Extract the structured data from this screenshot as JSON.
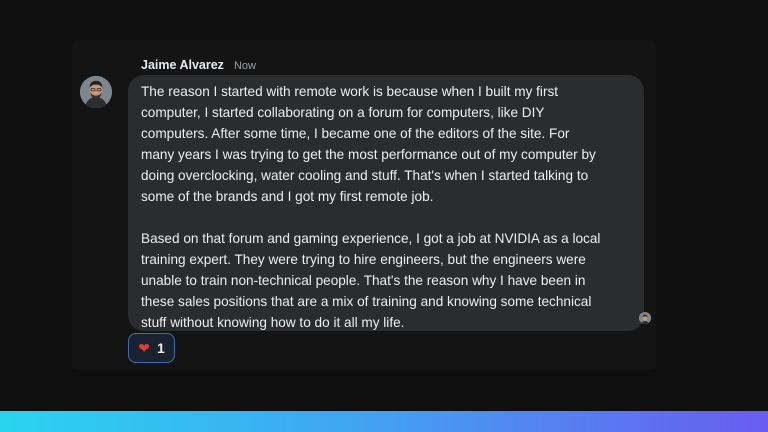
{
  "message": {
    "sender": "Jaime Alvarez",
    "timestamp": "Now",
    "paragraphs": [
      "The reason I started with remote work is because when I built my first computer, I started collaborating on a forum for computers, like DIY computers. After some time, I became one of the editors of the site. For many years I was trying to get the most performance out of my computer by doing overclocking, water cooling and stuff. That's when I started talking to some of the brands and I got my first remote job.",
      "Based on that forum and gaming experience, I got a job at NVIDIA as a local training expert. They were trying to hire engineers, but the engineers were unable to train non-technical people. That's the reason why I have been in these sales positions that are a mix of training and knowing some technical stuff without knowing how to do it all my life."
    ],
    "text": "The reason I started with remote work is because when I built my first\ncomputer, I started collaborating on a forum for computers, like DIY\ncomputers. After some time, I became one of the editors of the site. For\nmany years I was trying to get the most performance out of my computer by\ndoing overclocking, water cooling and stuff. That's when I started talking to\nsome of the brands and I got my first remote job.\n\nBased on that forum and gaming experience, I got a job at NVIDIA as a local\ntraining expert. They were trying to hire engineers, but the engineers were\nunable to train non-technical people. That's the reason why I have been in\nthese sales positions that are a mix of training and knowing some technical\nstuff without knowing how to do it all my life."
  },
  "reaction": {
    "emoji_icon": "heart-icon",
    "emoji": "❤",
    "count": "1"
  },
  "colors": {
    "bubble": "#2b2c2e",
    "background": "#0f0f10",
    "reaction_border": "#3b6fb3",
    "gradient_start": "#2ad4f0",
    "gradient_end": "#6a5cf0"
  }
}
